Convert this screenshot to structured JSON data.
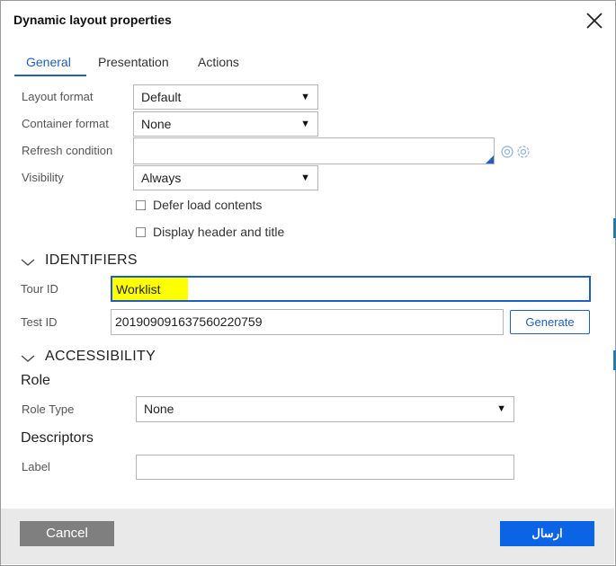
{
  "dialog": {
    "title": "Dynamic layout properties"
  },
  "tabs": [
    {
      "label": "General",
      "active": true
    },
    {
      "label": "Presentation",
      "active": false
    },
    {
      "label": "Actions",
      "active": false
    }
  ],
  "general": {
    "layout_format": {
      "label": "Layout format",
      "value": "Default"
    },
    "container_format": {
      "label": "Container format",
      "value": "None"
    },
    "refresh_condition": {
      "label": "Refresh condition",
      "value": ""
    },
    "visibility": {
      "label": "Visibility",
      "value": "Always"
    },
    "defer_load": {
      "label": "Defer load contents",
      "checked": false
    },
    "display_header": {
      "label": "Display header and title",
      "checked": false
    }
  },
  "identifiers": {
    "title": "IDENTIFIERS",
    "tour_id": {
      "label": "Tour ID",
      "value": "Worklist"
    },
    "test_id": {
      "label": "Test ID",
      "value": "20190909163756022​0759"
    },
    "generate_label": "Generate"
  },
  "accessibility": {
    "title": "ACCESSIBILITY",
    "role_heading": "Role",
    "role_type": {
      "label": "Role Type",
      "value": "None"
    },
    "descriptors_heading": "Descriptors",
    "label_field": {
      "label": "Label",
      "value": ""
    }
  },
  "footer": {
    "cancel_label": "Cancel",
    "submit_label": "ارسال"
  },
  "icons": {
    "close": "close-icon",
    "condition_builder": "gear-icon",
    "dropdown": "caret-down-icon",
    "expand": "chevron-down-icon"
  },
  "colors": {
    "accent": "#1f5fbf",
    "submit": "#0b63e5",
    "cancel": "#7f7f7f",
    "highlight": "#ffff00",
    "footer": "#e9e9e9"
  }
}
